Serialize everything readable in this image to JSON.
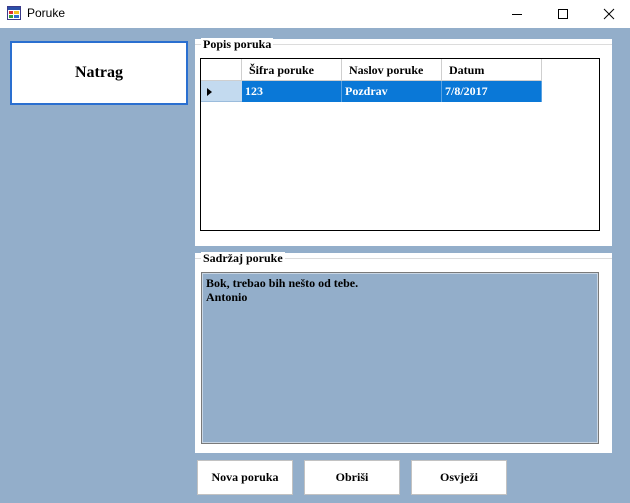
{
  "window": {
    "title": "Poruke",
    "controls": [
      "minimize-icon",
      "maximize-icon",
      "close-icon"
    ]
  },
  "buttons": {
    "back": "Natrag",
    "new_message": "Nova poruka",
    "delete": "Obriši",
    "refresh": "Osvježi"
  },
  "message_list": {
    "title": "Popis poruka",
    "columns": [
      "Šifra poruke",
      "Naslov poruke",
      "Datum"
    ],
    "rows": [
      {
        "selected": true,
        "cells": [
          "123",
          "Pozdrav",
          "7/8/2017"
        ]
      }
    ]
  },
  "message_content": {
    "title": "Sadržaj poruke",
    "text": "Bok, trebao bih nešto od tebe.\nAntonio"
  },
  "colors": {
    "client_background": "#93aeca",
    "selection": "#0a78d7",
    "focused_button_border": "#2a6fd0"
  }
}
